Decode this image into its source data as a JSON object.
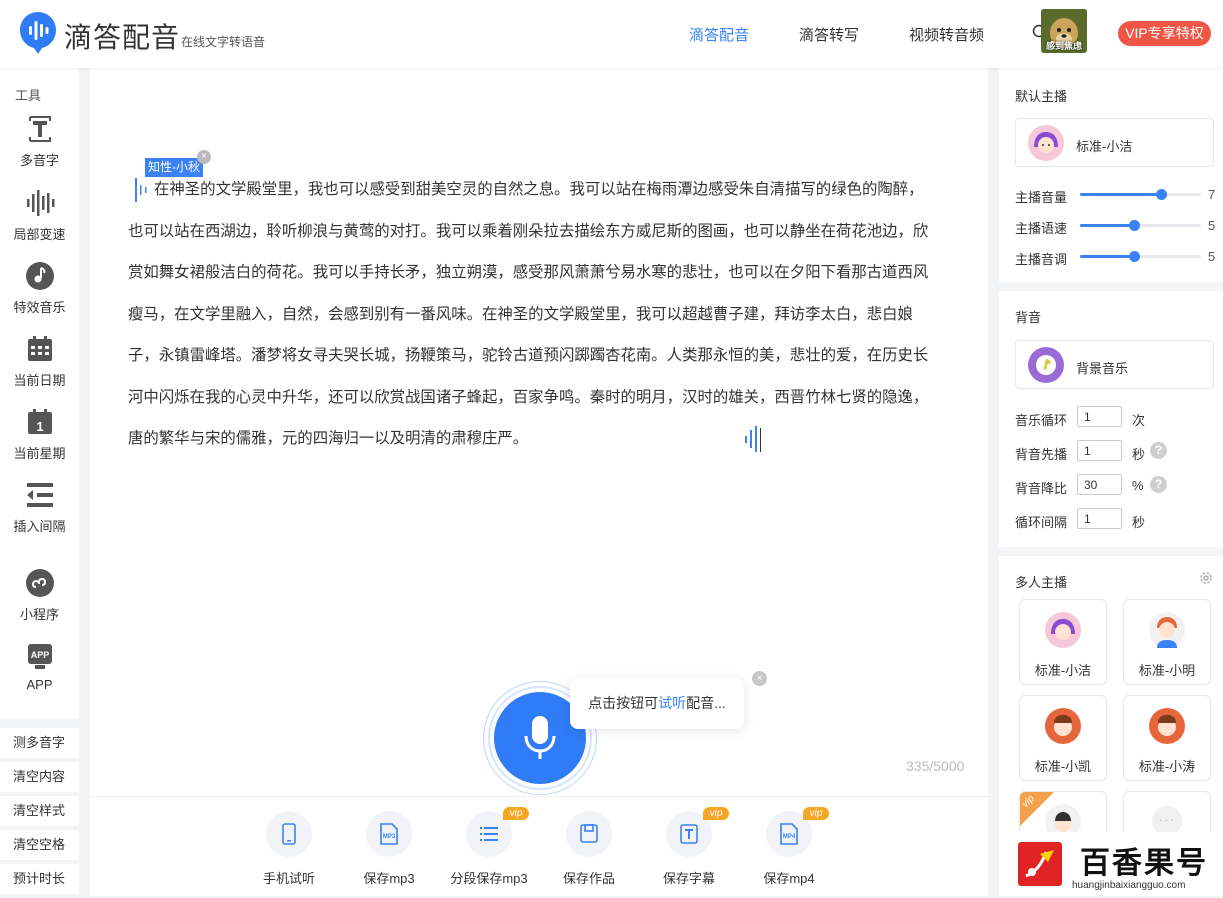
{
  "header": {
    "app_name": "滴答配音",
    "app_subtitle": "在线文字转语音",
    "nav": [
      "滴答配音",
      "滴答转写",
      "视频转音频"
    ],
    "avatar_caption": "感到焦虑",
    "vip_button": "VIP专享特权"
  },
  "tools": {
    "title": "工具",
    "items": [
      {
        "label": "多音字",
        "icon": "polyphone-icon"
      },
      {
        "label": "局部变速",
        "icon": "speed-wave-icon"
      },
      {
        "label": "特效音乐",
        "icon": "music-note-icon"
      },
      {
        "label": "当前日期",
        "icon": "calendar-icon"
      },
      {
        "label": "当前星期",
        "icon": "calendar-week-icon"
      },
      {
        "label": "插入间隔",
        "icon": "insert-pause-icon"
      },
      {
        "label": "小程序",
        "icon": "mini-program-icon"
      },
      {
        "label": "APP",
        "icon": "app-icon"
      }
    ],
    "buttons": [
      "测多音字",
      "清空内容",
      "清空样式",
      "清空空格",
      "预计时长"
    ]
  },
  "editor": {
    "voice_tag": "知性-小秋",
    "text": "在神圣的文学殿堂里，我也可以感受到甜美空灵的自然之息。我可以站在梅雨潭边感受朱自清描写的绿色的陶醉，也可以站在西湖边，聆听柳浪与黄莺的对打。我可以乘着刚朵拉去描绘东方威尼斯的图画，也可以静坐在荷花池边，欣赏如舞女裙般洁白的荷花。我可以手持长矛，独立朔漠，感受那风萧萧兮易水寒的悲壮，也可以在夕阳下看那古道西风瘦马，在文学里融入，自然，会感到别有一番风味。在神圣的文学殿堂里，我可以超越曹子建，拜访李太白，悲白娘子，永镇雷峰塔。潘梦将女寻夫哭长城，扬鞭策马，驼铃古道预闪踯躅杏花南。人类那永恒的美，悲壮的爱，在历史长河中闪烁在我的心灵中升华，还可以欣赏战国诸子蜂起，百家争鸣。秦时的明月，汉时的雄关，西晋竹林七贤的隐逸，唐的繁华与宋的儒雅，元的四海归一以及明清的肃穆庄严。",
    "counter": "335/5000",
    "tip_prefix": "点击按钮可",
    "tip_highlight": "试听",
    "tip_suffix": "配音...",
    "vip_label": "vip",
    "actions": [
      {
        "label": "手机试听",
        "icon": "phone-icon",
        "vip": false
      },
      {
        "label": "保存mp3",
        "icon": "mp3-file-icon",
        "vip": false
      },
      {
        "label": "分段保存mp3",
        "icon": "list-icon",
        "vip": true
      },
      {
        "label": "保存作品",
        "icon": "save-icon",
        "vip": false
      },
      {
        "label": "保存字幕",
        "icon": "subtitle-icon",
        "vip": true
      },
      {
        "label": "保存mp4",
        "icon": "mp4-file-icon",
        "vip": true
      }
    ]
  },
  "default_anchor": {
    "title": "默认主播",
    "voice": "标准-小洁",
    "sliders": [
      {
        "label": "主播音量",
        "value": "7",
        "fraction": 0.67
      },
      {
        "label": "主播语速",
        "value": "5",
        "fraction": 0.45
      },
      {
        "label": "主播音调",
        "value": "5",
        "fraction": 0.45
      }
    ]
  },
  "background": {
    "title": "背音",
    "track": "背景音乐",
    "fields": [
      {
        "label": "音乐循环",
        "value": "1",
        "unit": "次",
        "help": false
      },
      {
        "label": "背音先播",
        "value": "1",
        "unit": "秒",
        "help": true
      },
      {
        "label": "背音降比",
        "value": "30",
        "unit": "%",
        "help": true
      },
      {
        "label": "循环间隔",
        "value": "1",
        "unit": "秒",
        "help": false
      }
    ]
  },
  "multi_anchor": {
    "title": "多人主播",
    "voices": [
      "标准-小洁",
      "标准-小明",
      "标准-小凯",
      "标准-小涛"
    ],
    "vip_label": "vip",
    "more": "···"
  },
  "watermark": {
    "text": "百香果号",
    "url": "huangjinbaixiangguo.com"
  },
  "colors": {
    "accent": "#3b82f6",
    "vip_red": "#f05545",
    "vip_orange": "#f5a623"
  }
}
